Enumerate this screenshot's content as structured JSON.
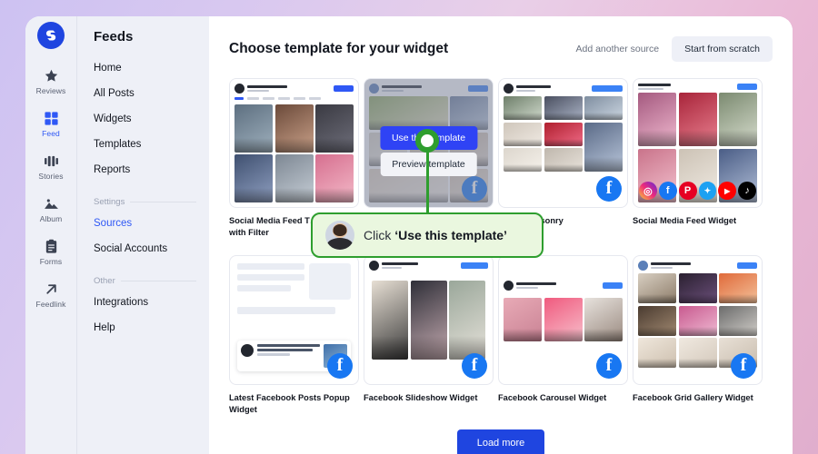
{
  "theme": {
    "accent": "#2f58f5",
    "brand_blue": "#1f45e0",
    "callout_green": "#2e9e2e",
    "callout_bg": "#eaf7df",
    "facebook_blue": "#1877f2",
    "panel_bg": "#eef0f7"
  },
  "rail": {
    "logo_name": "feedlink-logo",
    "items": [
      {
        "label": "Reviews",
        "icon": "star-icon",
        "active": false
      },
      {
        "label": "Feed",
        "icon": "grid-squares-icon",
        "active": true
      },
      {
        "label": "Stories",
        "icon": "stories-bars-icon",
        "active": false
      },
      {
        "label": "Album",
        "icon": "mountain-photo-icon",
        "active": false
      },
      {
        "label": "Forms",
        "icon": "clipboard-icon",
        "active": false
      },
      {
        "label": "Feedlink",
        "icon": "arrow-up-right-icon",
        "active": false
      }
    ]
  },
  "sidebar": {
    "title": "Feeds",
    "items": [
      {
        "label": "Home",
        "active": false
      },
      {
        "label": "All Posts",
        "active": false
      },
      {
        "label": "Widgets",
        "active": false
      },
      {
        "label": "Templates",
        "active": false
      },
      {
        "label": "Reports",
        "active": false
      }
    ],
    "groups": [
      {
        "label": "Settings",
        "items": [
          {
            "label": "Sources",
            "active": true
          },
          {
            "label": "Social Accounts",
            "active": false
          }
        ]
      },
      {
        "label": "Other",
        "items": [
          {
            "label": "Integrations",
            "active": false
          },
          {
            "label": "Help",
            "active": false
          }
        ]
      }
    ]
  },
  "header": {
    "title": "Choose template for your widget",
    "add_source_label": "Add another source",
    "scratch_label": "Start from scratch"
  },
  "overlay": {
    "use_label": "Use this template",
    "preview_label": "Preview template"
  },
  "callout": {
    "prefix": "Click",
    "emphasis": "‘Use this template’",
    "avatar_name": "callout-avatar"
  },
  "templates": [
    {
      "caption": "Social Media Feed T… Slider with Filter",
      "badge": "facebook",
      "layout": "grid6"
    },
    {
      "caption": "",
      "badge": "facebook",
      "layout": "recipe",
      "hovered": true
    },
    {
      "caption": "…Feed Masonry",
      "badge": "facebook",
      "layout": "masonry"
    },
    {
      "caption": "Social Media Feed Widget",
      "badge": "socialrow",
      "layout": "cards6"
    },
    {
      "caption": "Latest Facebook Posts Popup Widget",
      "badge": "facebook",
      "layout": "popup"
    },
    {
      "caption": "Facebook Slideshow Widget",
      "badge": "facebook",
      "layout": "slideshow"
    },
    {
      "caption": "Facebook Carousel Widget",
      "badge": "facebook",
      "layout": "carousel"
    },
    {
      "caption": "Facebook Grid Gallery Widget",
      "badge": "facebook",
      "layout": "gallery"
    }
  ],
  "footer": {
    "load_more_label": "Load more"
  },
  "social_icons": [
    {
      "name": "instagram-icon",
      "glyph": "◎",
      "color": "#e1306c"
    },
    {
      "name": "facebook-icon",
      "glyph": "f",
      "color": "#1877f2"
    },
    {
      "name": "pinterest-icon",
      "glyph": "P",
      "color": "#e60023"
    },
    {
      "name": "twitter-icon",
      "glyph": "✉",
      "color": "#1da1f2"
    },
    {
      "name": "youtube-icon",
      "glyph": "▶",
      "color": "#ff0000"
    },
    {
      "name": "tiktok-icon",
      "glyph": "♪",
      "color": "#010101"
    }
  ]
}
